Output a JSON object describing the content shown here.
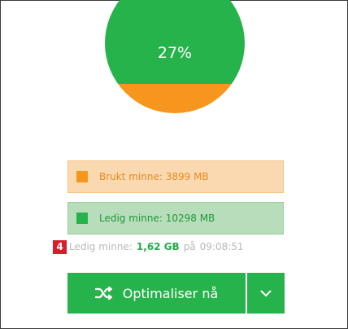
{
  "memory": {
    "used_percent": 27,
    "used_label_text": "27%",
    "colors": {
      "used": "#27b34b",
      "free": "#f7961e"
    }
  },
  "legend": {
    "used": {
      "label": "Brukt minne: 3899 MB",
      "color": "#f7961e"
    },
    "free": {
      "label": "Ledig minne: 10298 MB",
      "color": "#27b34b"
    }
  },
  "status": {
    "marker": "4",
    "prefix": "Ledig minne:",
    "value": "1,62 GB",
    "connector": "på",
    "time": "09:08:51"
  },
  "actions": {
    "optimize_label": "Optimaliser nå",
    "optimize_icon": "shuffle-icon",
    "dropdown_icon": "chevron-down-icon"
  }
}
